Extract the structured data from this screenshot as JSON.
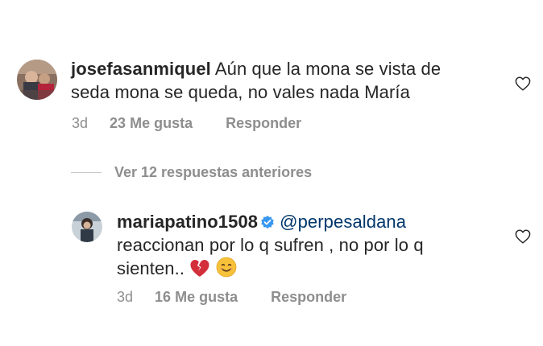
{
  "comment": {
    "username": "josefasanmiquel",
    "text": "Aún  que la mona se vista de",
    "text_line2": "seda mona se queda, no vales nada María",
    "time": "3d",
    "likes": "23 Me gusta",
    "reply_label": "Responder",
    "like_icon": "heart-outline-icon"
  },
  "view_replies": {
    "label": "Ver 12 respuestas anteriores"
  },
  "reply": {
    "username": "mariapatino1508",
    "verified_icon": "verified-badge-icon",
    "mention": "@perpesaldana",
    "text_line1": "reaccionan por lo q sufren , no por lo q",
    "text_line2": "sienten..",
    "emojis": [
      "broken-heart-emoji",
      "smiling-face-emoji"
    ],
    "time": "3d",
    "likes": "16 Me gusta",
    "reply_label": "Responder",
    "like_icon": "heart-outline-icon"
  },
  "colors": {
    "text": "#262626",
    "secondary": "#8e8e8e",
    "mention": "#00376b",
    "verified": "#3897f0",
    "broken_heart": "#d32f3a",
    "smile": "#f7c23a"
  }
}
